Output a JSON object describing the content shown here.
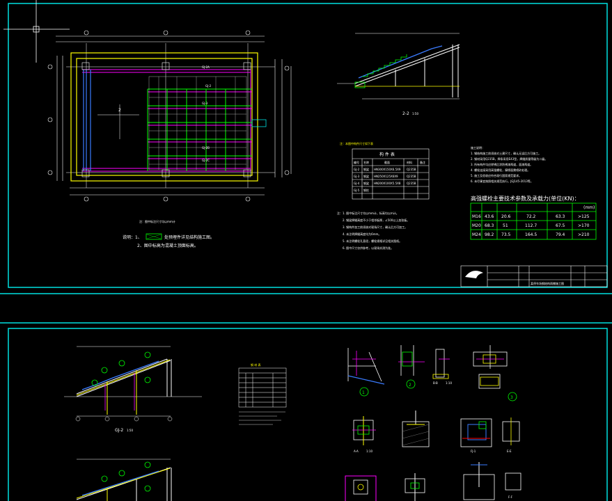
{
  "colors": {
    "background": "#000000",
    "frame": "#00e0e0",
    "white": "#ffffff",
    "yellow": "#ffff00",
    "magenta": "#ff00ff",
    "green": "#00ff00",
    "blue": "#3a7bff",
    "cyan_dim": "#00a0a0"
  },
  "sheet1": {
    "plan_caption": "注：图中标注尺寸均以mm计",
    "notes_label": "说明：1、",
    "note1_text": "处预埋件详见结构施工图。",
    "note2": "2、图中标高为混凝土顶面标高。",
    "plan_labels": {
      "gj2a": "GJ-2A",
      "gj2": "GJ-2",
      "gj3": "GJ-3",
      "gj2b": "GJ-2B",
      "gj2c": "GJ-2C",
      "mark": "2"
    },
    "section_label": "2-2",
    "section_scale": "1:50",
    "table_heading": "注：本图中构件尺寸如下表",
    "table_title": "构 件 表",
    "table_headers": [
      "编号",
      "名称",
      "截面",
      "材料",
      "备注"
    ],
    "table_rows": [
      [
        "GJ-2",
        "钢梁",
        "HN300X150X6.5X9",
        "Q235B",
        ""
      ],
      [
        "GJ-3",
        "钢梁",
        "HN250X125X6X9",
        "Q235B",
        ""
      ],
      [
        "GJ-4",
        "钢梁",
        "HN200X100X5.5X8",
        "Q235B",
        ""
      ],
      [
        "GJ-5",
        "钢柱",
        "",
        "",
        ""
      ]
    ],
    "general_notes_title": "施工说明：",
    "general_notes": [
      "1. 钢结构施工前须核对土建尺寸，确认无误后方可施工。",
      "2. 钢材采用Q235B，焊条采用E43型，焊缝质量等级为二级。",
      "3. 所有构件均应除锈后涂防锈漆两道，面漆两道。",
      "4. 螺栓连接采用高强螺栓，摩擦面需喷砂处理。",
      "5. 施工及验收应符合现行国家规范要求。",
      "6. 未尽事宜按照相关规范执行，JGJ145-2013等。"
    ],
    "numbered_notes": [
      "注：1. 图中标注尺寸均以mm计，标高均以m计。",
      "2. 钢梁焊缝高度不小于相邻板厚，∠500以上加劲板。",
      "3. 钢构件加工前须核对现场尺寸，确认后方可加工。",
      "4. 未注明焊缝高度均为6mm。",
      "5. 未注明螺栓孔直径，螺栓规格详见相关图纸。",
      "6. 图中尺寸仅供参考，以现场实测为准。"
    ],
    "bolt_table_title": "高强螺栓主要技术参数及承载力(单位(KN)：",
    "bolt_unit": "(mm)",
    "bolt_rows": [
      [
        "M16",
        "43.6",
        "20.6",
        "72.2",
        "63.3",
        ">125"
      ],
      [
        "M20",
        "68.3",
        "51",
        "112.7",
        "67.5",
        ">170"
      ],
      [
        "M24",
        "98.2",
        "73.5",
        "164.5",
        "79.4",
        ">210"
      ]
    ],
    "title_block": "某停车场钢结构雨棚施工图"
  },
  "sheet2": {
    "elevation_label": "GJ-2",
    "elevation_scale": "1:50",
    "small_table_title": "钢 材 表",
    "detail_labels": {
      "d1": "1",
      "d2": "2",
      "d3": "3",
      "bb": "B-B",
      "bb_scale": "1:10",
      "aa": "A-A",
      "aa_scale": "1:10",
      "fj": "FJ-1",
      "ee": "E-E",
      "ff": "F-F"
    },
    "marker_letters": [
      "A",
      "B",
      "C",
      "D",
      "E"
    ]
  }
}
